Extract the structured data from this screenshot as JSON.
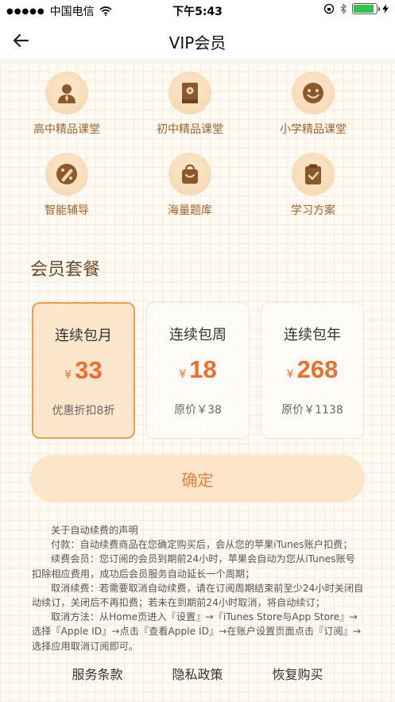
{
  "status_bar": {
    "carrier": "中国电信",
    "time": "下午5:43",
    "battery_fill": 0.9
  },
  "nav": {
    "title": "VIP会员"
  },
  "features": [
    {
      "label": "高中精品课堂",
      "icon": "teacher-icon"
    },
    {
      "label": "初中精品课堂",
      "icon": "book-icon"
    },
    {
      "label": "小学精品课堂",
      "icon": "smile-icon"
    },
    {
      "label": "智能辅导",
      "icon": "pencil-ruler-icon"
    },
    {
      "label": "海量题库",
      "icon": "bag-icon"
    },
    {
      "label": "学习方案",
      "icon": "clipboard-check-icon"
    }
  ],
  "section_title": "会员套餐",
  "plans": [
    {
      "name": "连续包月",
      "currency": "¥",
      "price": "33",
      "note": "优惠折扣8折",
      "selected": true
    },
    {
      "name": "连续包周",
      "currency": "¥",
      "price": "18",
      "note": "原价￥38",
      "selected": false
    },
    {
      "name": "连续包年",
      "currency": "¥",
      "price": "268",
      "note": "原价￥1138",
      "selected": false
    }
  ],
  "confirm_label": "确定",
  "notice": {
    "title": "关于自动续费的声明",
    "paragraphs": [
      "付款：自动续费商品在您确定购买后，会从您的苹果iTunes账户扣费；",
      "续费会员：您订阅的会员到期前24小时，苹果会自动为您从iTunes账号扣除相应费用，成功后会员服务自动延长一个周期；",
      "取消续费：若需要取消自动续费，请在订阅周期结束前至少24小时关闭自动续订，关闭后不再扣费；若未在到期前24小时取消，将自动续订；",
      "取消方法：从Home页进入『设置』→『iTunes Store与App Store』→选择『Apple ID』→点击『查看Apple ID』→在账户设置页面点击『订阅』→选择应用取消订阅即可。"
    ]
  },
  "footer": {
    "terms": "服务条款",
    "privacy": "隐私政策",
    "restore": "恢复购买"
  },
  "colors": {
    "accent": "#f26c2a",
    "label": "#a0612a",
    "selected_border": "#f09a4a",
    "icon_fill": "#8a5a2e"
  }
}
